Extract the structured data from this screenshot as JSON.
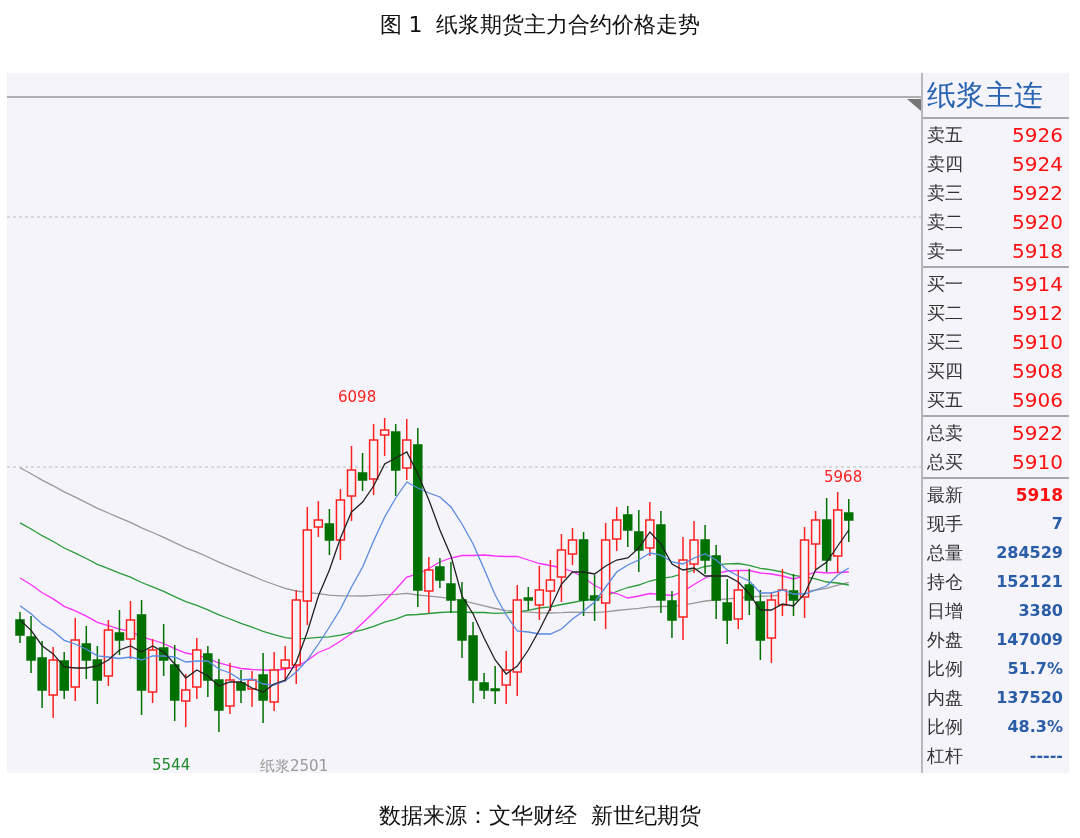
{
  "caption": "图 1  纸浆期货主力合约价格走势",
  "chart": {
    "high_label": "6098",
    "recent_high_label": "5968",
    "low_label": "5544",
    "contract_label": "纸浆2501"
  },
  "quote_panel": {
    "title": "纸浆主连",
    "sections": [
      {
        "rows": [
          {
            "label": "卖五",
            "value": "5926",
            "kind": "price"
          },
          {
            "label": "卖四",
            "value": "5924",
            "kind": "price"
          },
          {
            "label": "卖三",
            "value": "5922",
            "kind": "price"
          },
          {
            "label": "卖二",
            "value": "5920",
            "kind": "price"
          },
          {
            "label": "卖一",
            "value": "5918",
            "kind": "price"
          }
        ]
      },
      {
        "rows": [
          {
            "label": "买一",
            "value": "5914",
            "kind": "price"
          },
          {
            "label": "买二",
            "value": "5912",
            "kind": "price"
          },
          {
            "label": "买三",
            "value": "5910",
            "kind": "price"
          },
          {
            "label": "买四",
            "value": "5908",
            "kind": "price"
          },
          {
            "label": "买五",
            "value": "5906",
            "kind": "price"
          }
        ]
      },
      {
        "rows": [
          {
            "label": "总卖",
            "value": "5922",
            "kind": "price"
          },
          {
            "label": "总买",
            "value": "5910",
            "kind": "price"
          }
        ]
      },
      {
        "rows": [
          {
            "label": "最新",
            "value": "5918",
            "kind": "latest"
          },
          {
            "label": "现手",
            "value": "7",
            "kind": "stat"
          },
          {
            "label": "总量",
            "value": "284529",
            "kind": "stat"
          },
          {
            "label": "持仓",
            "value": "152121",
            "kind": "stat"
          },
          {
            "label": "日增",
            "value": "3380",
            "kind": "stat"
          },
          {
            "label": "外盘",
            "value": "147009",
            "kind": "stat"
          },
          {
            "label": "比例",
            "value": "51.7%",
            "kind": "stat"
          },
          {
            "label": "内盘",
            "value": "137520",
            "kind": "stat"
          },
          {
            "label": "比例",
            "value": "48.3%",
            "kind": "stat"
          },
          {
            "label": "杠杆",
            "value": "-----",
            "kind": "stat"
          }
        ]
      }
    ]
  },
  "source": "数据来源：文华财经  新世纪期货"
}
